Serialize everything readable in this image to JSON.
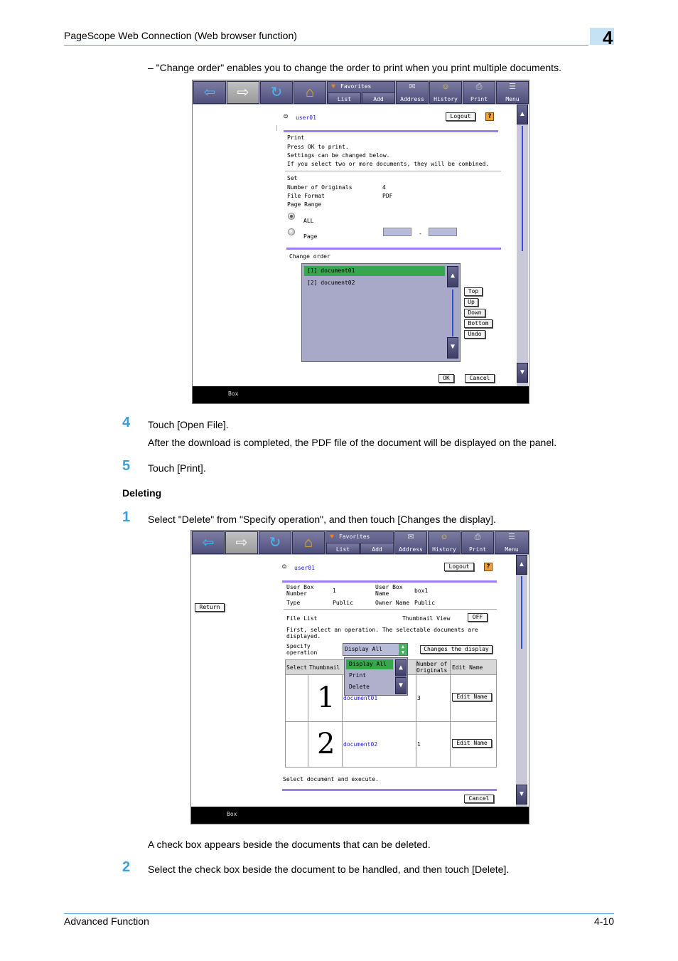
{
  "header": {
    "title": "PageScope Web Connection (Web browser function)",
    "chapter": "4"
  },
  "footer": {
    "left": "Advanced Function",
    "right": "4-10"
  },
  "intro_bullet": "–   \"Change order\" enables you to change the order to print when you print multiple documents.",
  "steps": [
    {
      "num": "4",
      "text": "Touch [Open File].",
      "detail": "After the download is completed, the PDF file of the document will be displayed on the panel."
    },
    {
      "num": "5",
      "text": "Touch [Print]."
    },
    {
      "num": "1",
      "text": "Select \"Delete\" from \"Specify operation\", and then touch [Changes the display].",
      "detail": "A check box appears beside the documents that can be deleted."
    },
    {
      "num": "2",
      "text": "Select the check box beside the document to be handled, and then touch [Delete]."
    }
  ],
  "section_heading": "Deleting",
  "toolbar": {
    "favorites": "Favorites",
    "list": "List",
    "add": "Add",
    "address": "Address",
    "history": "History",
    "print": "Print",
    "menu": "Menu"
  },
  "screen1": {
    "user": "user01",
    "logout": "Logout",
    "help": "?",
    "title": "Print",
    "line1": "Press OK to print.",
    "line2": "Settings can be changed below.",
    "line3": "If you select two or more documents, they will be combined.",
    "set": "Set",
    "num_originals_label": "Number of Originals",
    "num_originals_value": "4",
    "file_format_label": "File Format",
    "file_format_value": "PDF",
    "page_range_label": "Page Range",
    "all_label": "ALL",
    "page_label": "Page",
    "dash": "-",
    "change_order": "Change order",
    "items": [
      "[1]  document01",
      "[2]  document02"
    ],
    "order_buttons": [
      "Top",
      "Up",
      "Down",
      "Bottom",
      "Undo"
    ],
    "ok": "OK",
    "cancel": "Cancel",
    "status": "Box"
  },
  "screen2": {
    "user": "user01",
    "logout": "Logout",
    "help": "?",
    "return": "Return",
    "user_box_number_label": "User Box Number",
    "user_box_number_value": "1",
    "user_box_name_label": "User Box Name",
    "user_box_name_value": "box1",
    "type_label": "Type",
    "type_value": "Public",
    "owner_label": "Owner Name",
    "owner_value": "Public",
    "file_list": "File List",
    "thumbnail_view": "Thumbnail View",
    "off": "OFF",
    "instruction": "First, select an operation. The selectable documents are displayed.",
    "specify_operation": "Specify operation",
    "selected_operation": "Display All",
    "operations": [
      "Display All",
      "Print",
      "Delete"
    ],
    "changes_display": "Changes the display",
    "columns": [
      "Select",
      "Thumbnail",
      "Number of Originals",
      "Edit Name"
    ],
    "rows": [
      {
        "thumb": "1",
        "name": "document01",
        "originals": "3",
        "edit": "Edit Name"
      },
      {
        "thumb": "2",
        "name": "document02",
        "originals": "1",
        "edit": "Edit Name"
      }
    ],
    "footer_text": "Select document and execute.",
    "cancel": "Cancel",
    "status": "Box"
  }
}
